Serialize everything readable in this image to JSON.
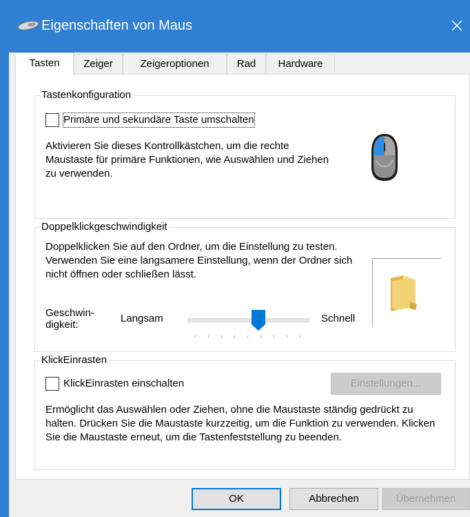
{
  "window": {
    "title": "Eigenschaften von Maus",
    "title_icon": "mouse-icon",
    "close_icon": "close-icon",
    "accent": "#2f7fd2"
  },
  "tabs": [
    {
      "label": "Tasten",
      "active": true
    },
    {
      "label": "Zeiger",
      "active": false
    },
    {
      "label": "Zeigeroptionen",
      "active": false
    },
    {
      "label": "Rad",
      "active": false
    },
    {
      "label": "Hardware",
      "active": false
    }
  ],
  "button_config": {
    "title": "Tastenkonfiguration",
    "checkbox_label": "Primäre und sekundäre Taste umschalten",
    "checked": false,
    "description": "Aktivieren Sie dieses Kontrollkästchen, um die rechte Maustaste für primäre Funktionen, wie Auswählen und Ziehen zu verwenden.",
    "image": "mouse-image"
  },
  "double_click": {
    "title": "Doppelklickgeschwindigkeit",
    "description": "Doppelklicken Sie auf den Ordner, um die Einstellung zu testen. Verwenden Sie eine langsamere Einstellung, wenn der Ordner sich nicht öffnen oder schließen lässt.",
    "speed_label_line1": "Geschwin-",
    "speed_label_line2": "digkeit:",
    "slow_label": "Langsam",
    "fast_label": "Schnell",
    "slider_level": 0.6,
    "test_image": "folder-icon"
  },
  "click_lock": {
    "title": "KlickEinrasten",
    "checkbox_label": "KlickEinrasten einschalten",
    "checked": false,
    "settings_button": "Einstellungen...",
    "description": "Ermöglicht das Auswählen oder Ziehen, ohne die Maustaste ständig gedrückt zu halten. Drücken Sie die Maustaste kurzzeitig, um die Funktion zu verwenden. Klicken Sie die Maustaste erneut, um die Tastenfeststellung zu beenden."
  },
  "footer": {
    "ok": "OK",
    "cancel": "Abbrechen",
    "apply": "Übernehmen"
  }
}
